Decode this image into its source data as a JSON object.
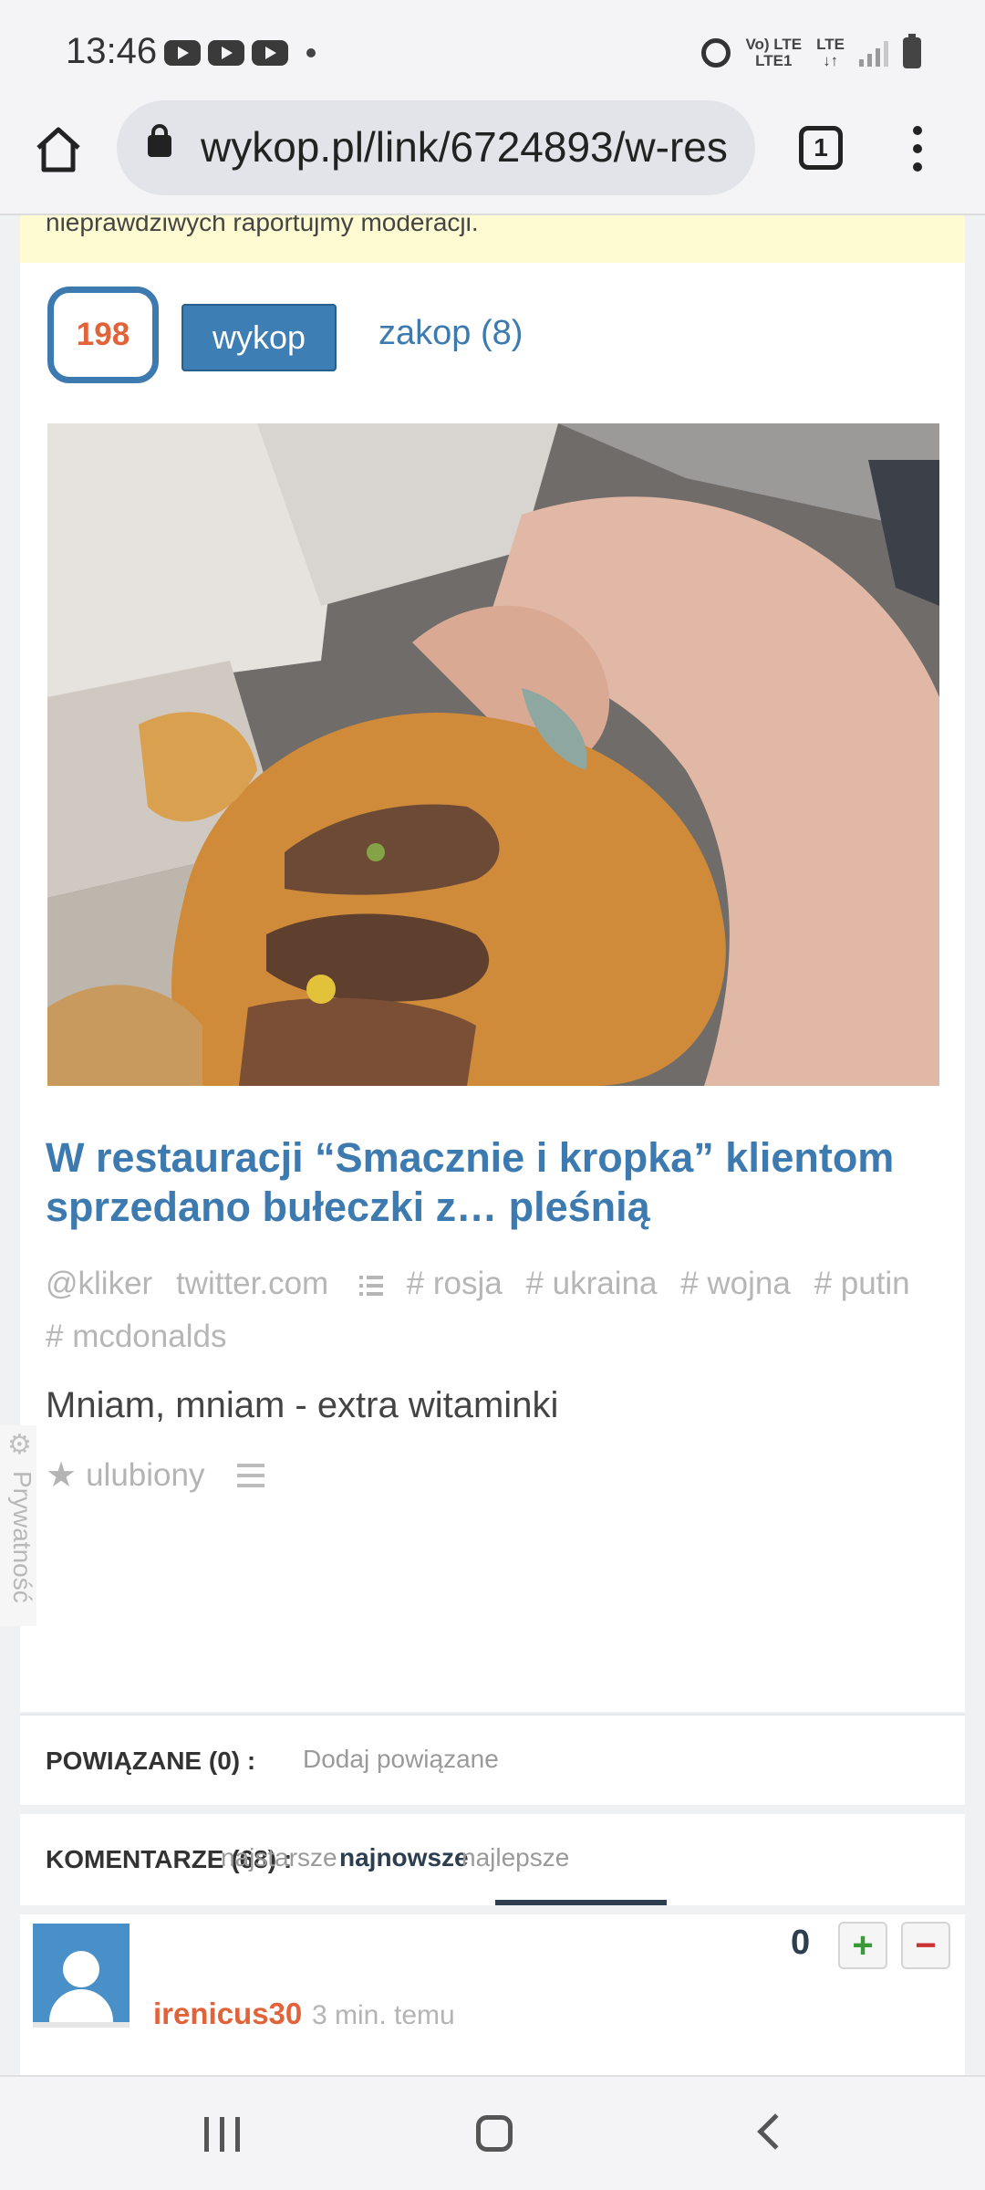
{
  "status_bar": {
    "time": "13:46",
    "network_top": "Vo) LTE",
    "network_bottom": "LTE1",
    "lte_label": "LTE"
  },
  "browser": {
    "url": "wykop.pl/link/6724893/w-res",
    "tab_count": "1"
  },
  "notice": {
    "text": "nieprawdziwych raportujmy moderacji."
  },
  "link": {
    "votes": "198",
    "wykop_label": "wykop",
    "zakop_label": "zakop (8)",
    "image_alt": "Photo of a bitten burger with moldy bun",
    "title": "W restauracji “Smacznie i kropka” klientom sprzedano bułeczki z… pleśnią",
    "author": "@kliker",
    "source": "twitter.com",
    "tags": [
      "# rosja",
      "# ukraina",
      "# wojna",
      "# putin",
      "# mcdonalds"
    ],
    "description": "Mniam, mniam - extra witaminki",
    "favorite_label": "ulubiony"
  },
  "privacy_tab": "Prywatność",
  "related": {
    "label": "POWIĄZANE (0) :",
    "add_label": "Dodaj powiązane"
  },
  "comments": {
    "label": "KOMENTARZE (68) :",
    "tabs": [
      "najstarsze",
      "najnowsze",
      "najlepsze"
    ],
    "active_tab": "najnowsze"
  },
  "comment": {
    "score": "0",
    "plus": "+",
    "minus": "−",
    "username": "irenicus30",
    "time": "3 min. temu"
  },
  "colors": {
    "link_blue": "#3c7ab0",
    "vote_orange": "#e0633a",
    "notice_yellow": "#fefbd2"
  }
}
